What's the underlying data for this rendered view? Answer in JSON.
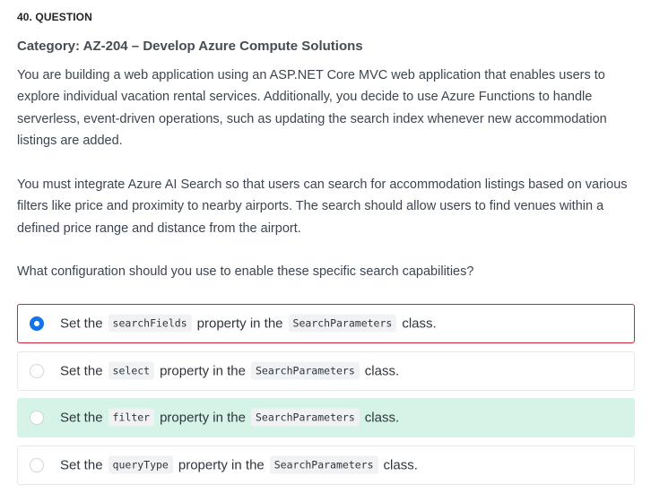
{
  "question": {
    "number_label": "40. QUESTION",
    "category": "Category: AZ-204 – Develop Azure Compute Solutions",
    "paragraphs": [
      "You are building a web application using an ASP.NET Core MVC web application that enables users to explore individual vacation rental services. Additionally, you decide to use Azure Functions to handle serverless, event-driven operations, such as updating the search index whenever new accommodation listings are added.",
      "You must integrate Azure AI Search so that users can search for accommodation listings based on various filters like price and proximity to nearby airports. The search should allow users to find venues within a defined price range and distance from the airport.",
      "What configuration should you use to enable these specific search capabilities?"
    ]
  },
  "options": [
    {
      "prefix": "Set the",
      "property": "searchFields",
      "middle": "property in the",
      "class_name": "SearchParameters",
      "suffix": "class.",
      "selected": true,
      "state": "incorrect"
    },
    {
      "prefix": "Set the",
      "property": "select",
      "middle": "property in the",
      "class_name": "SearchParameters",
      "suffix": "class.",
      "selected": false,
      "state": "neutral"
    },
    {
      "prefix": "Set the",
      "property": "filter",
      "middle": "property in the",
      "class_name": "SearchParameters",
      "suffix": "class.",
      "selected": false,
      "state": "correct"
    },
    {
      "prefix": "Set the",
      "property": "queryType",
      "middle": "property in the",
      "class_name": "SearchParameters",
      "suffix": "class.",
      "selected": false,
      "state": "neutral"
    }
  ],
  "colors": {
    "selected_radio": "#1274e8",
    "incorrect_border": "#c9283a",
    "correct_background": "#d5f3e6",
    "text": "#3d4550"
  }
}
